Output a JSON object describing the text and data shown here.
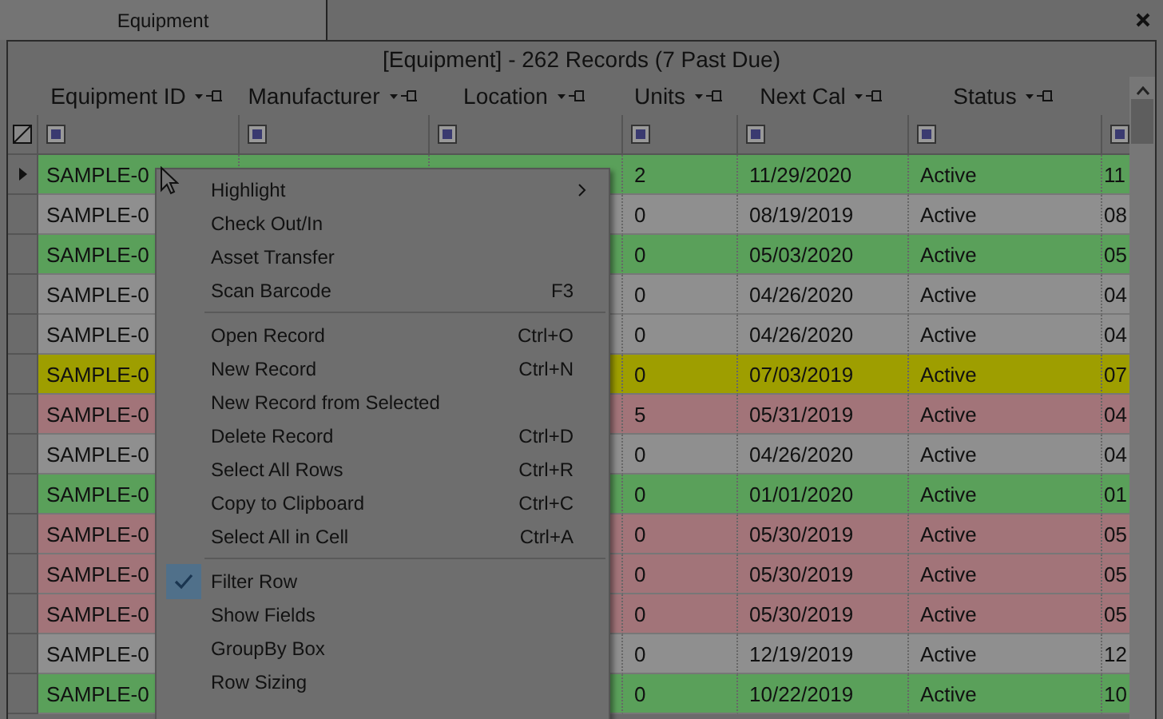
{
  "tab": {
    "label": "Equipment",
    "selected": true
  },
  "grid_title": "[Equipment] - 262 Records (7 Past Due)",
  "columns": [
    {
      "label": "Equipment ID"
    },
    {
      "label": "Manufacturer"
    },
    {
      "label": "Location"
    },
    {
      "label": "Units"
    },
    {
      "label": "Next Cal"
    },
    {
      "label": "Status"
    },
    {}
  ],
  "rows": [
    {
      "current": true,
      "color": "#5aa05a",
      "cells": [
        "SAMPLE-0",
        "",
        "",
        "2",
        "11/29/2020",
        "Active",
        "11"
      ]
    },
    {
      "current": false,
      "color": "#8f8f8f",
      "cells": [
        "SAMPLE-0",
        "",
        "",
        "0",
        "08/19/2019",
        "Active",
        "08"
      ]
    },
    {
      "current": false,
      "color": "#5aa05a",
      "cells": [
        "SAMPLE-0",
        "",
        "",
        "0",
        "05/03/2020",
        "Active",
        "05"
      ]
    },
    {
      "current": false,
      "color": "#8f8f8f",
      "cells": [
        "SAMPLE-0",
        "",
        "",
        "0",
        "04/26/2020",
        "Active",
        "04"
      ]
    },
    {
      "current": false,
      "color": "#8f8f8f",
      "cells": [
        "SAMPLE-0",
        "",
        "",
        "0",
        "04/26/2020",
        "Active",
        "04"
      ]
    },
    {
      "current": false,
      "color": "#9e9e00",
      "cells": [
        "SAMPLE-0",
        "",
        "",
        "0",
        "07/03/2019",
        "Active",
        "07"
      ]
    },
    {
      "current": false,
      "color": "#a27479",
      "cells": [
        "SAMPLE-0",
        "",
        "",
        "5",
        "05/31/2019",
        "Active",
        "04"
      ]
    },
    {
      "current": false,
      "color": "#8f8f8f",
      "cells": [
        "SAMPLE-0",
        "",
        "",
        "0",
        "04/26/2020",
        "Active",
        "04"
      ]
    },
    {
      "current": false,
      "color": "#5aa05a",
      "cells": [
        "SAMPLE-0",
        "",
        "",
        "0",
        "01/01/2020",
        "Active",
        "01"
      ]
    },
    {
      "current": false,
      "color": "#a27479",
      "cells": [
        "SAMPLE-0",
        "",
        "",
        "0",
        "05/30/2019",
        "Active",
        "05"
      ]
    },
    {
      "current": false,
      "color": "#a27479",
      "cells": [
        "SAMPLE-0",
        "",
        "",
        "0",
        "05/30/2019",
        "Active",
        "05"
      ]
    },
    {
      "current": false,
      "color": "#a27479",
      "cells": [
        "SAMPLE-0",
        "",
        "",
        "0",
        "05/30/2019",
        "Active",
        "05"
      ]
    },
    {
      "current": false,
      "color": "#8f8f8f",
      "cells": [
        "SAMPLE-0",
        "",
        "",
        "0",
        "12/19/2019",
        "Active",
        "12"
      ]
    },
    {
      "current": false,
      "color": "#5aa05a",
      "cells": [
        "SAMPLE-0",
        "",
        "",
        "0",
        "10/22/2019",
        "Active",
        "10"
      ]
    }
  ],
  "context_menu": [
    {
      "kind": "item",
      "label": "Highlight",
      "submenu": true,
      "checked": false
    },
    {
      "kind": "item",
      "label": "Check Out/In",
      "checked": false
    },
    {
      "kind": "item",
      "label": "Asset Transfer",
      "checked": false
    },
    {
      "kind": "item",
      "label": "Scan Barcode",
      "shortcut": "F3",
      "checked": false
    },
    {
      "kind": "separator"
    },
    {
      "kind": "item",
      "label": "Open Record",
      "shortcut": "Ctrl+O",
      "checked": false
    },
    {
      "kind": "item",
      "label": "New Record",
      "shortcut": "Ctrl+N",
      "checked": false
    },
    {
      "kind": "item",
      "label": "New Record from Selected",
      "checked": false
    },
    {
      "kind": "item",
      "label": "Delete Record",
      "shortcut": "Ctrl+D",
      "checked": false
    },
    {
      "kind": "item",
      "label": "Select All Rows",
      "shortcut": "Ctrl+R",
      "checked": false
    },
    {
      "kind": "item",
      "label": "Copy to Clipboard",
      "shortcut": "Ctrl+C",
      "checked": false
    },
    {
      "kind": "item",
      "label": "Select All in Cell",
      "shortcut": "Ctrl+A",
      "checked": false
    },
    {
      "kind": "separator"
    },
    {
      "kind": "item",
      "label": "Filter Row",
      "checked": true
    },
    {
      "kind": "item",
      "label": "Show Fields",
      "checked": false
    },
    {
      "kind": "item",
      "label": "GroupBy Box",
      "checked": false
    },
    {
      "kind": "item",
      "label": "Row Sizing",
      "checked": false
    }
  ]
}
